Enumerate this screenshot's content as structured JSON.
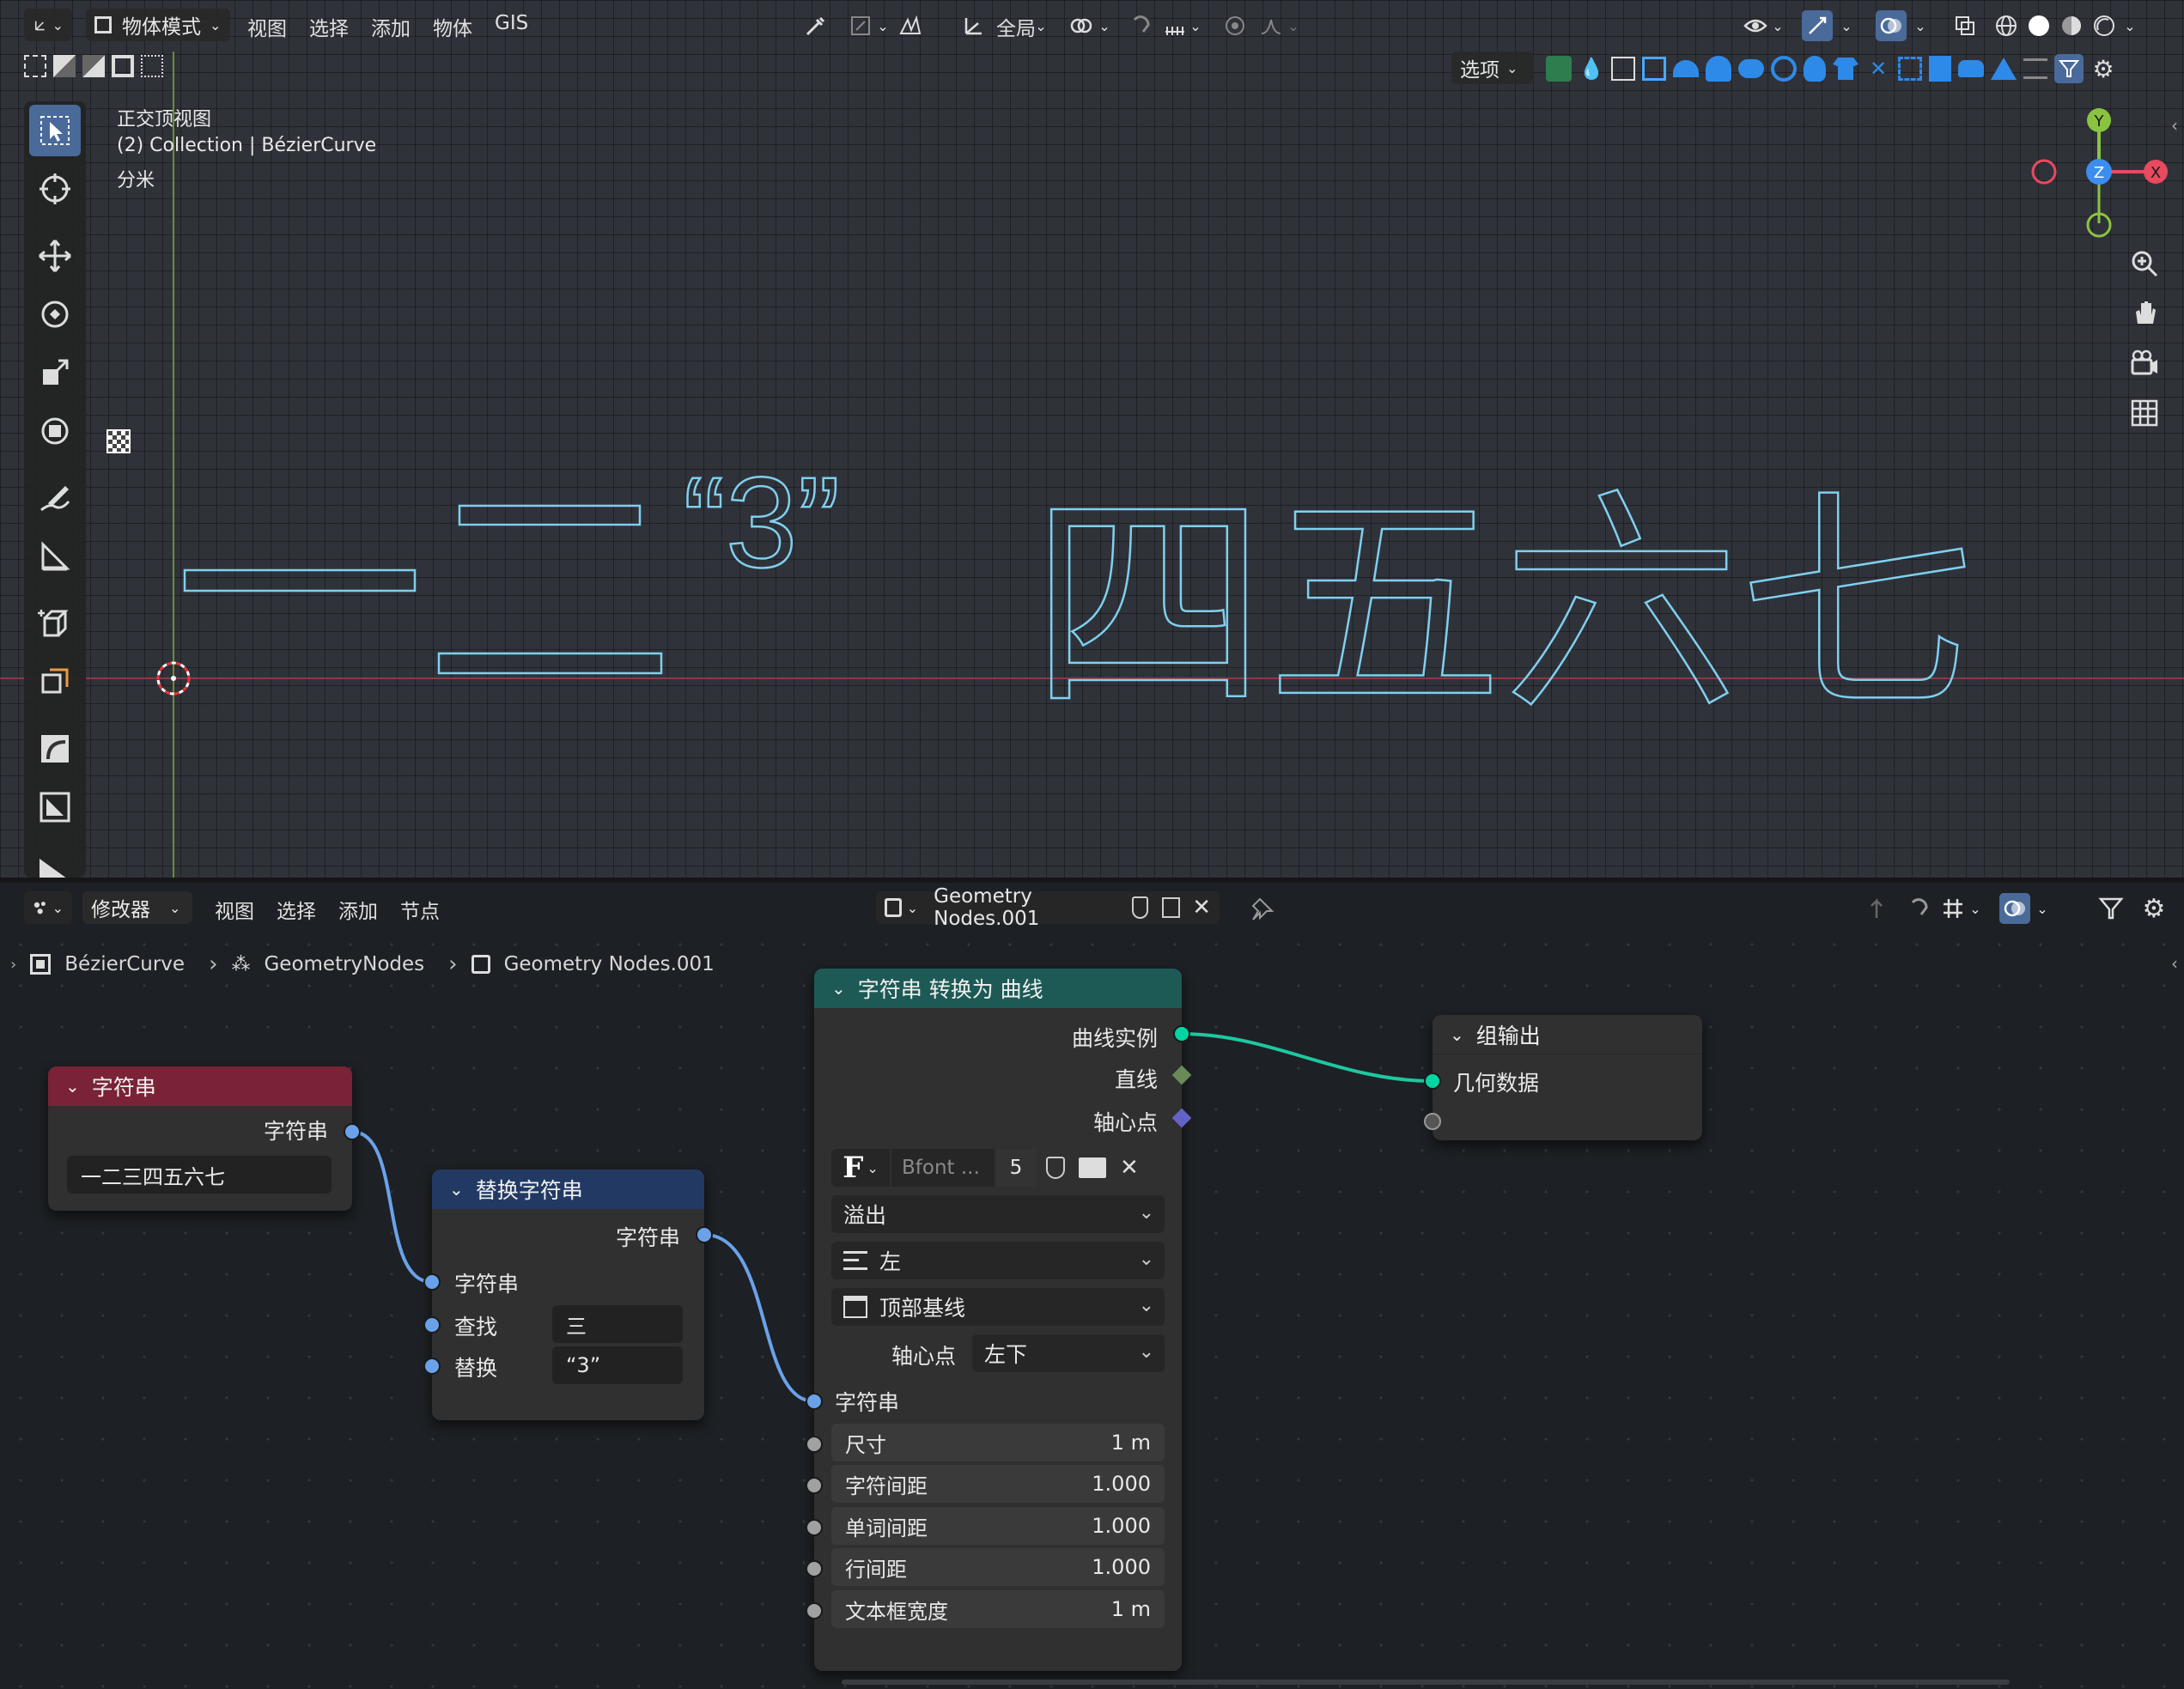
{
  "viewport": {
    "mode_label": "物体模式",
    "menus": [
      "视图",
      "选择",
      "添加",
      "物体",
      "GIS"
    ],
    "transform_global": "全局",
    "options_label": "选项",
    "info": {
      "view_name": "正交顶视图",
      "collection": "(2) Collection | BézierCurve",
      "units": "分米"
    },
    "gizmo": {
      "y": "Y",
      "z": "Z",
      "x": "X"
    }
  },
  "node_editor": {
    "editor_type_label": "修改器",
    "menus": [
      "视图",
      "选择",
      "添加",
      "节点"
    ],
    "node_group_name": "Geometry Nodes.001",
    "breadcrumb": [
      "BézierCurve",
      "GeometryNodes",
      "Geometry Nodes.001"
    ],
    "nodes": {
      "string_input": {
        "title": "字符串",
        "output_label": "字符串",
        "value": "一二三四五六七",
        "header_color": "#7a2336"
      },
      "replace_string": {
        "title": "替换字符串",
        "output_label": "字符串",
        "input_string": "字符串",
        "find_label": "查找",
        "find_value": "三",
        "replace_label": "替换",
        "replace_value": "“3”",
        "header_color": "#223a63"
      },
      "string_to_curves": {
        "title": "字符串 转换为 曲线",
        "out_curve_instances": "曲线实例",
        "out_line": "直线",
        "out_pivot": "轴心点",
        "font_name": "Bfont ...",
        "font_users": "5",
        "overflow": "溢出",
        "align_x": "左",
        "align_y": "顶部基线",
        "pivot_label": "轴心点",
        "pivot_value": "左下",
        "in_string": "字符串",
        "fields": [
          {
            "label": "尺寸",
            "value": "1 m"
          },
          {
            "label": "字符间距",
            "value": "1.000"
          },
          {
            "label": "单词间距",
            "value": "1.000"
          },
          {
            "label": "行间距",
            "value": "1.000"
          },
          {
            "label": "文本框宽度",
            "value": "1 m"
          }
        ],
        "header_color": "#1d5a55"
      },
      "group_output": {
        "title": "组输出",
        "geometry_label": "几何数据",
        "header_color": "#303030"
      }
    },
    "colors": {
      "string_socket": "#6aa2ea",
      "geometry_socket": "#00d6a3",
      "float_socket": "#a1a1a1",
      "vector_socket": "#6363c7",
      "bool_socket": "#6a8a5a"
    }
  }
}
